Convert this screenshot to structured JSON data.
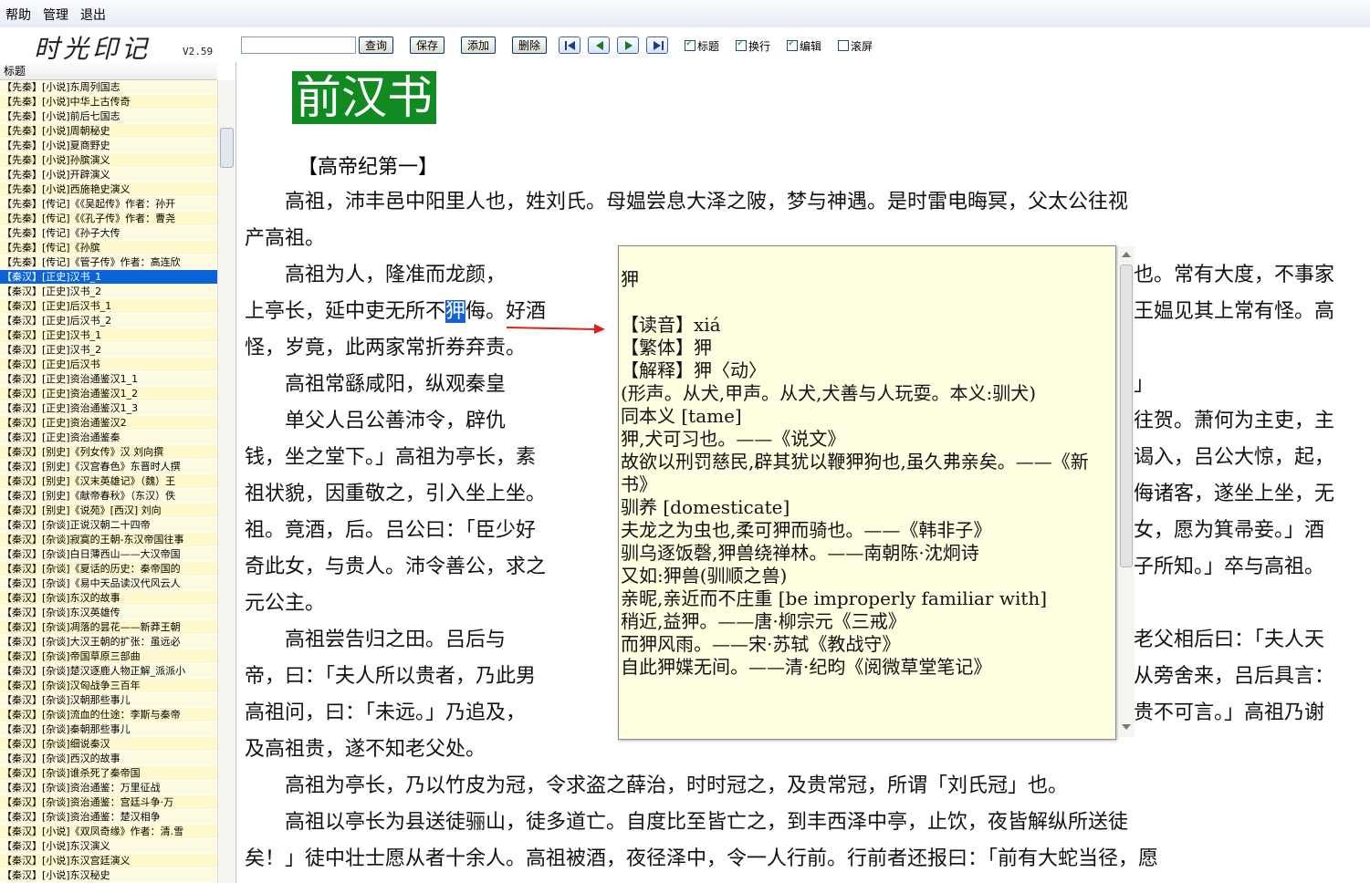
{
  "menu": [
    "帮助",
    "管理",
    "退出"
  ],
  "app": {
    "logo": "时光印记",
    "version": "V2.59"
  },
  "toolbar": {
    "search_value": "",
    "buttons": [
      "查询",
      "保存",
      "添加",
      "删除"
    ],
    "checkboxes": [
      {
        "label": "标题",
        "checked": true
      },
      {
        "label": "换行",
        "checked": true
      },
      {
        "label": "编辑",
        "checked": true
      },
      {
        "label": "滚屏",
        "checked": false
      }
    ]
  },
  "sidebar": {
    "header": "标题",
    "items": [
      "【先秦】[小说]东周列国志",
      "【先秦】[小说]中华上古传奇",
      "【先秦】[小说]前后七国志",
      "【先秦】[小说]周朝秘史",
      "【先秦】[小说]夏商野史",
      "【先秦】[小说]孙膑演义",
      "【先秦】[小说]开辟演义",
      "【先秦】[小说]西施艳史演义",
      "【先秦】[传记]《《吴起传》作者：孙开",
      "【先秦】[传记]《《孔子传》作者：曹尧",
      "【先秦】[传记]《孙子大传",
      "【先秦】[传记]《孙膑",
      "【先秦】[传记]《管子传》作者：高连欣",
      "【秦汉】[正史]汉书_1",
      "【秦汉】[正史]汉书_2",
      "【秦汉】[正史]后汉书_1",
      "【秦汉】[正史]后汉书_2",
      "【秦汉】[正史]汉书_1",
      "【秦汉】[正史]汉书_2",
      "【秦汉】[正史]后汉书",
      "【秦汉】[正史]资治通鉴汉1_1",
      "【秦汉】[正史]资治通鉴汉1_2",
      "【秦汉】[正史]资治通鉴汉1_3",
      "【秦汉】[正史]资治通鉴汉2",
      "【秦汉】[正史]资治通鉴秦",
      "【秦汉】[别史]《列女传》汉 刘向撰",
      "【秦汉】[别史]《汉宫春色》东晋时人撰",
      "【秦汉】[别史]《汉末英雄记》（魏）王",
      "【秦汉】[别史]《献帝春秋》（东汉）佚",
      "【秦汉】[别史]《说苑》[西汉] 刘向",
      "【秦汉】[杂谈]正说汉朝二十四帝",
      "【秦汉】[杂谈]寂寞的王朝-东汉帝国往事",
      "【秦汉】[杂谈]白日薄西山——大汉帝国",
      "【秦汉】[杂谈]《夏话的历史：秦帝国的",
      "【秦汉】[杂谈]《易中天品读汉代风云人",
      "【秦汉】[杂谈]东汉的故事",
      "【秦汉】[杂谈]东汉英雄传",
      "【秦汉】[杂谈]凋落的昙花——新莽王朝",
      "【秦汉】[杂谈]大汉王朝的扩张：虽远必",
      "【秦汉】[杂谈]帝国草原三部曲",
      "【秦汉】[杂谈]楚汉逐鹿人物正解_派派小",
      "【秦汉】[杂谈]汉匈战争三百年",
      "【秦汉】[杂谈]汉朝那些事儿",
      "【秦汉】[杂谈]流血的仕途：李斯与秦帝",
      "【秦汉】[杂谈]秦朝那些事儿",
      "【秦汉】[杂谈]细说秦汉",
      "【秦汉】[杂谈]西汉的故事",
      "【秦汉】[杂谈]谁杀死了秦帝国",
      "【秦汉】[杂谈]资治通鉴：万里征战",
      "【秦汉】[杂谈]资治通鉴：宫廷斗争·万",
      "【秦汉】[杂谈]资治通鉴：楚汉相争",
      "【秦汉】[小说]《双凤奇缘》作者：清.雪",
      "【秦汉】[小说]东汉演义",
      "【秦汉】[小说]东汉宫廷演义",
      "【秦汉】[小说]东汉秘史"
    ],
    "selected_index": 13
  },
  "content": {
    "title": "前汉书",
    "chapter": "【高帝纪第一】",
    "lines": [
      {
        "t": "　　高祖，沛丰邑中阳里人也，姓刘氏。母媪尝息大泽之陂，梦与神遇。是时雷电晦冥，父太公往视"
      },
      {
        "t": "产高祖。"
      },
      {
        "t": "　　高祖为人，隆准而龙颜，"
      },
      {
        "a": "上亭长，延中吏无所不",
        "h": "狎",
        "b": "侮。好酒"
      },
      {
        "t": "怪，岁竟，此两家常折券弃责。"
      },
      {
        "t": "　　高祖常繇咸阳，纵观秦皇"
      },
      {
        "t": "　　单父人吕公善沛令，辟仇"
      },
      {
        "t": "钱，坐之堂下。」高祖为亭长，素"
      },
      {
        "t": "祖状貌，因重敬之，引入坐上坐。"
      },
      {
        "t": "祖。竟酒，后。吕公曰：「臣少好"
      },
      {
        "t": "奇此女，与贵人。沛令善公，求之"
      },
      {
        "t": "元公主。"
      },
      {
        "t": "　　高祖尝告归之田。吕后与"
      },
      {
        "t": "帝，曰：「夫人所以贵者，乃此男"
      },
      {
        "t": "高祖问，曰：「未远。」乃追及，"
      },
      {
        "t": "及高祖贵，遂不知老父处。"
      },
      {
        "t": "　　高祖为亭长，乃以竹皮为冠，令求盗之薛治，时时冠之，及贵常冠，所谓「刘氏冠」也。"
      },
      {
        "t": "　　高祖以亭长为县送徒骊山，徒多道亡。自度比至皆亡之，到丰西泽中亭，止饮，夜皆解纵所送徒"
      },
      {
        "t": "矣！」徒中壮士愿从者十余人。高祖被酒，夜径泽中，令一人行前。行前者还报曰：「前有大蛇当径，愿"
      }
    ],
    "right_fragments": [
      {
        "line": 2,
        "t": "也。常有大度，不事家"
      },
      {
        "line": 3,
        "t": "王媪见其上常有怪。高"
      },
      {
        "line": 5,
        "t": "」"
      },
      {
        "line": 6,
        "t": "往贺。萧何为主吏，主"
      },
      {
        "line": 7,
        "t": "谒入，吕公大惊，起，"
      },
      {
        "line": 8,
        "t": "侮诸客，遂坐上坐，无"
      },
      {
        "line": 9,
        "t": "女，愿为箕帚妾。」酒"
      },
      {
        "line": 10,
        "t": "子所知。」卒与高祖。"
      },
      {
        "line": 12,
        "t": "老父相后曰：「夫人天"
      },
      {
        "line": 13,
        "t": "从旁舍来，吕后具言："
      },
      {
        "line": 14,
        "t": "贵不可言。」高祖乃谢"
      }
    ]
  },
  "popup": {
    "text": "狎\n\n【读音】xiá\n【繁体】狎\n【解释】狎〈动〉\n(形声。从犬,甲声。从犬,犬善与人玩耍。本义:驯犬)\n同本义 [tame]\n狎,犬可习也。——《说文》\n故欲以刑罚慈民,辟其犹以鞭狎狗也,虽久弗亲矣。——《新书》\n驯养 [domesticate]\n夫龙之为虫也,柔可狎而骑也。——《韩非子》\n驯乌逐饭磬,狎兽绕禅林。——南朝陈·沈炯诗\n又如:狎兽(驯顺之兽)\n亲昵,亲近而不庄重 [be improperly familiar with]\n稍近,益狎。——唐·柳宗元《三戒》\n而狎风雨。——宋·苏轼《教战守》\n自此狎媟无间。——清·纪昀《阅微草堂笔记》"
  }
}
